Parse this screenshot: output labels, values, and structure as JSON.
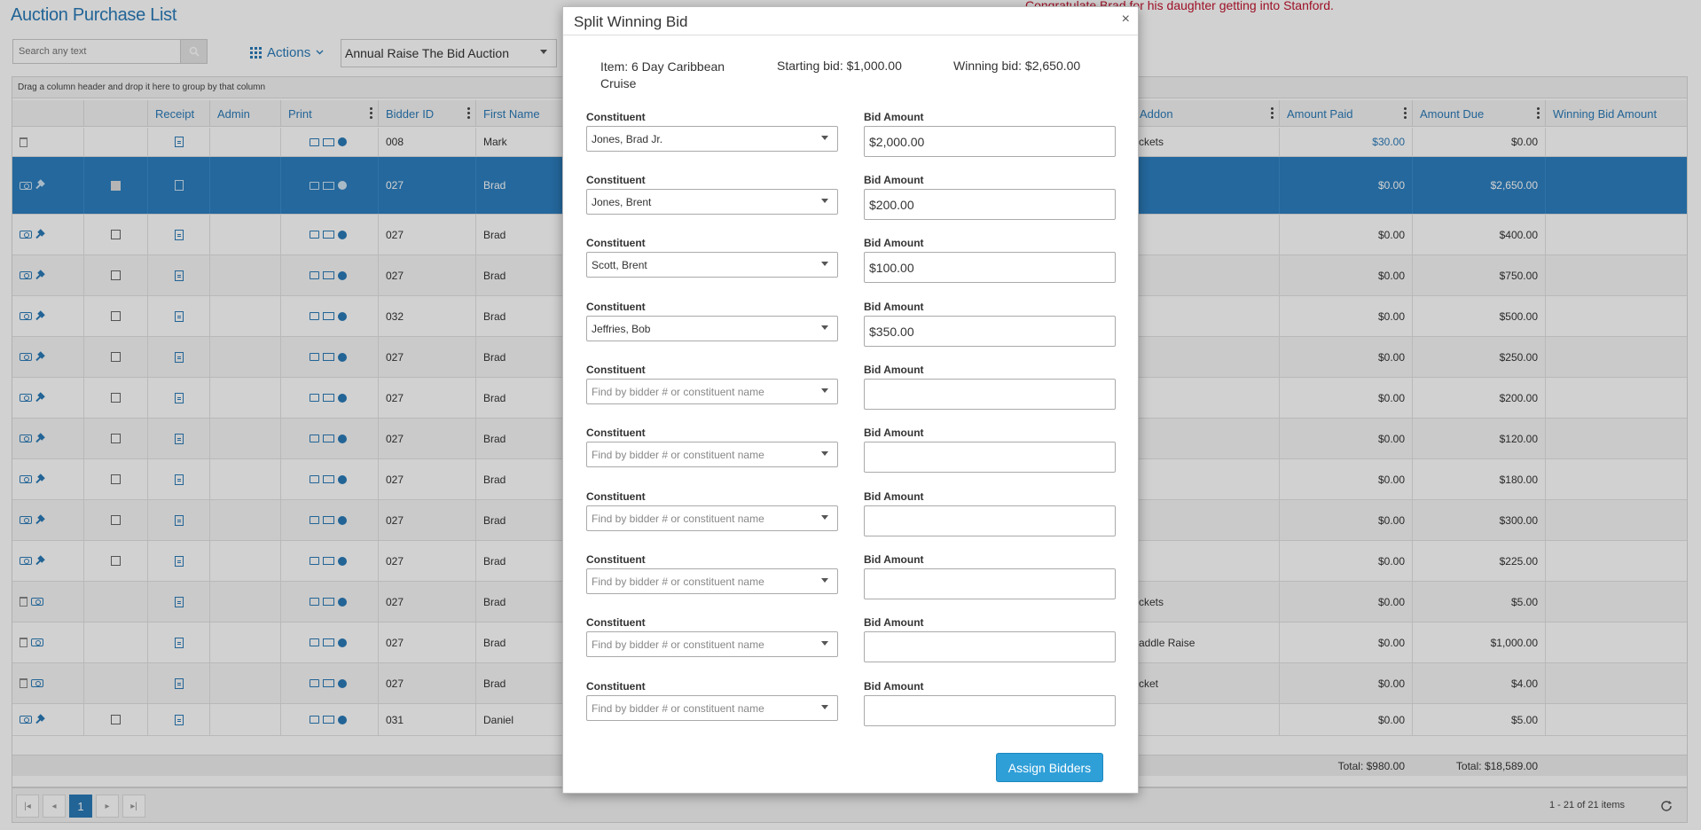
{
  "page": {
    "title": "Auction Purchase List",
    "announcement": "Congratulate Brad for his daughter getting into Stanford.",
    "search_placeholder": "Search any text",
    "actions_label": "Actions",
    "auction_selected": "Annual Raise The Bid Auction",
    "group_hint": "Drag a column header and drop it here to group by that column"
  },
  "grid": {
    "headers": {
      "receipt": "Receipt",
      "admin": "Admin",
      "print": "Print",
      "bidder_id": "Bidder ID",
      "first_name": "First Name",
      "addon": "Addon",
      "amount_paid": "Amount Paid",
      "amount_due": "Amount Due",
      "winning_bid_amount": "Winning Bid Amount"
    },
    "rows": [
      {
        "bidder_id": "008",
        "first_name": "Mark",
        "addon": "ckets",
        "amount_paid": "$30.00",
        "amount_due": "$0.00"
      },
      {
        "bidder_id": "027",
        "first_name": "Brad",
        "addon": "",
        "amount_paid": "$0.00",
        "amount_due": "$2,650.00"
      },
      {
        "bidder_id": "027",
        "first_name": "Brad",
        "addon": "",
        "amount_paid": "$0.00",
        "amount_due": "$400.00"
      },
      {
        "bidder_id": "027",
        "first_name": "Brad",
        "addon": "",
        "amount_paid": "$0.00",
        "amount_due": "$750.00"
      },
      {
        "bidder_id": "032",
        "first_name": "Brad",
        "addon": "",
        "amount_paid": "$0.00",
        "amount_due": "$500.00"
      },
      {
        "bidder_id": "027",
        "first_name": "Brad",
        "addon": "",
        "amount_paid": "$0.00",
        "amount_due": "$250.00"
      },
      {
        "bidder_id": "027",
        "first_name": "Brad",
        "addon": "",
        "amount_paid": "$0.00",
        "amount_due": "$200.00"
      },
      {
        "bidder_id": "027",
        "first_name": "Brad",
        "addon": "",
        "amount_paid": "$0.00",
        "amount_due": "$120.00"
      },
      {
        "bidder_id": "027",
        "first_name": "Brad",
        "addon": "",
        "amount_paid": "$0.00",
        "amount_due": "$180.00"
      },
      {
        "bidder_id": "027",
        "first_name": "Brad",
        "addon": "",
        "amount_paid": "$0.00",
        "amount_due": "$300.00"
      },
      {
        "bidder_id": "027",
        "first_name": "Brad",
        "addon": "",
        "amount_paid": "$0.00",
        "amount_due": "$225.00"
      },
      {
        "bidder_id": "027",
        "first_name": "Brad",
        "addon": "ckets",
        "amount_paid": "$0.00",
        "amount_due": "$5.00"
      },
      {
        "bidder_id": "027",
        "first_name": "Brad",
        "addon": "addle Raise",
        "amount_paid": "$0.00",
        "amount_due": "$1,000.00"
      },
      {
        "bidder_id": "027",
        "first_name": "Brad",
        "addon": "cket",
        "amount_paid": "$0.00",
        "amount_due": "$4.00"
      },
      {
        "bidder_id": "031",
        "first_name": "Daniel",
        "addon": "",
        "amount_paid": "$0.00",
        "amount_due": "$5.00"
      }
    ],
    "total_paid": "Total: $980.00",
    "total_due": "Total: $18,589.00",
    "current_page": "1",
    "page_info": "1 - 21 of 21 items"
  },
  "modal": {
    "title": "Split Winning Bid",
    "close_glyph": "×",
    "item": "Item: 6 Day Caribbean Cruise",
    "starting_bid": "Starting bid: $1,000.00",
    "winning_bid": "Winning bid: $2,650.00",
    "constituent_label": "Constituent",
    "bid_label": "Bid Amount",
    "placeholder": "Find by bidder # or constituent name",
    "entries": [
      {
        "constituent": "Jones, Brad Jr.",
        "bid": "$2,000.00"
      },
      {
        "constituent": "Jones, Brent",
        "bid": "$200.00"
      },
      {
        "constituent": "Scott, Brent",
        "bid": "$100.00"
      },
      {
        "constituent": "Jeffries, Bob",
        "bid": "$350.00"
      },
      {
        "constituent": "",
        "bid": ""
      },
      {
        "constituent": "",
        "bid": ""
      },
      {
        "constituent": "",
        "bid": ""
      },
      {
        "constituent": "",
        "bid": ""
      },
      {
        "constituent": "",
        "bid": ""
      },
      {
        "constituent": "",
        "bid": ""
      }
    ],
    "assign_label": "Assign Bidders"
  },
  "colors": {
    "accent": "#2a7ab8",
    "selected_row": "#2c7fc0",
    "primary_button": "#2f9fd8",
    "announcement": "#c0152f"
  }
}
